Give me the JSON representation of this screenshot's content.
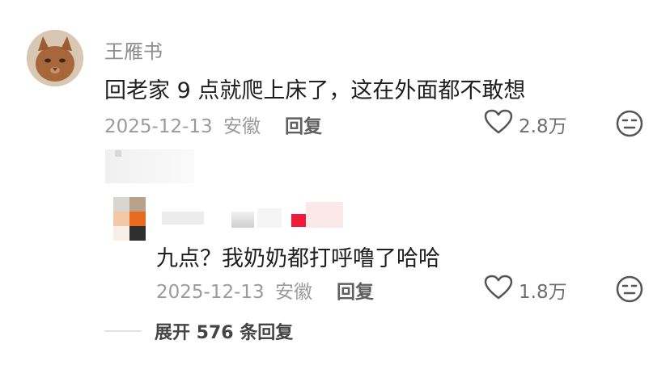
{
  "comment": {
    "username": "王雁书",
    "content": "回老家 9 点就爬上床了，这在外面都不敢想",
    "date": "2025-12-13",
    "location": "安徽",
    "reply_label": "回复",
    "like_count": "2.8万"
  },
  "reply": {
    "content": "九点？我奶奶都打呼噜了哈哈",
    "date": "2025-12-13",
    "location": "安徽",
    "reply_label": "回复",
    "like_count": "1.8万"
  },
  "expand": {
    "label": "展开 576 条回复"
  }
}
